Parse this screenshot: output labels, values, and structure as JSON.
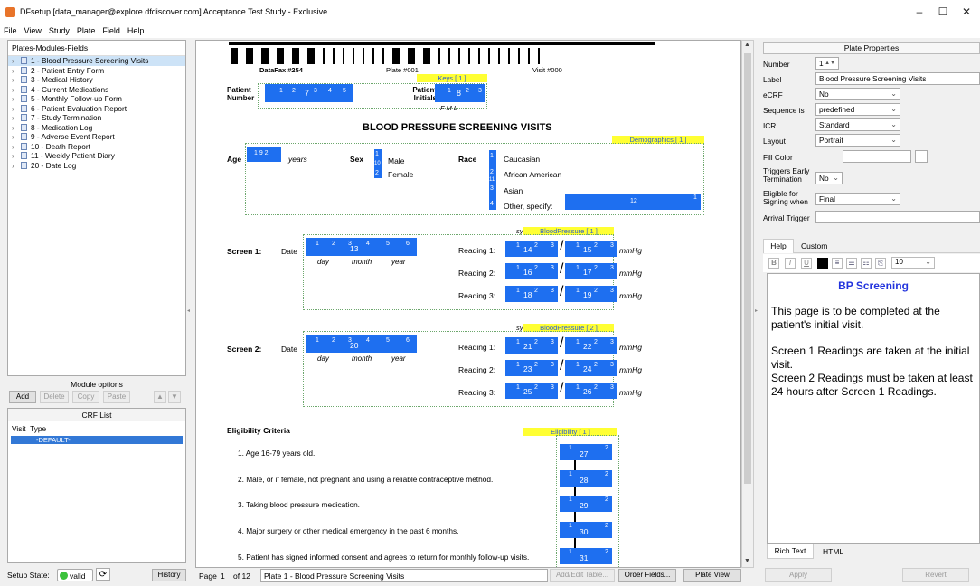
{
  "window": {
    "title": "DFsetup [data_manager@explore.dfdiscover.com] Acceptance Test Study - Exclusive",
    "controls": [
      "–",
      "☐",
      "✕"
    ]
  },
  "menu": [
    "File",
    "View",
    "Study",
    "Plate",
    "Field",
    "Help"
  ],
  "tree": {
    "header": "Plates-Modules-Fields",
    "items": [
      "1 - Blood Pressure Screening Visits",
      "2 - Patient Entry Form",
      "3 - Medical History",
      "4 - Current Medications",
      "5 - Monthly Follow-up Form",
      "6 - Patient Evaluation Report",
      "7 - Study Termination",
      "8 - Medication Log",
      "9 - Adverse Event Report",
      "10 - Death Report",
      "11 - Weekly Patient Diary",
      "20 - Date Log"
    ]
  },
  "module_options": {
    "label": "Module options",
    "buttons": [
      "Add",
      "Delete",
      "Copy",
      "Paste"
    ]
  },
  "crf_list": {
    "title": "CRF List",
    "columns": [
      "Visit",
      "Type"
    ],
    "rows": [
      "-DEFAULT-"
    ]
  },
  "status": {
    "label": "Setup State:",
    "value": "valid",
    "history": "History"
  },
  "form": {
    "header": {
      "datafax": "DataFax #254",
      "plate": "Plate #001",
      "visit": "Visit #000"
    },
    "keys_tag": "Keys [ 1 ]",
    "patient_number_label": "Patient Number",
    "patient_initials_label": "Patient Initials",
    "initials_letters": "F   M   L",
    "title": "BLOOD PRESSURE SCREENING VISITS",
    "demographics_tag": "Demographics [ 1 ]",
    "age_label": "Age",
    "years": "years",
    "sex_label": "Sex",
    "sex_options": [
      "Male",
      "Female"
    ],
    "race_label": "Race",
    "race_options": [
      "Caucasian",
      "African American",
      "Asian",
      "Other, specify:"
    ],
    "bp1_tag": "BloodPressure [ 1 ]",
    "bp2_tag": "BloodPressure [ 2 ]",
    "sys": "sy",
    "screen1": "Screen 1:",
    "screen2": "Screen 2:",
    "date": "Date",
    "day": "day",
    "month": "month",
    "year": "year",
    "readings": [
      "Reading 1:",
      "Reading 2:",
      "Reading 3:"
    ],
    "mmhg": "mmHg",
    "eligibility_title": "Eligibility Criteria",
    "eligibility_tag": "Eligibility [ 1 ]",
    "criteria": [
      "1.  Age 16-79 years old.",
      "2.  Male, or if female, not pregnant and using a reliable contraceptive method.",
      "3.  Taking blood pressure medication.",
      "4.  Major surgery or other medical emergency in the past 6 months.",
      "5.  Patient has signed informed consent and agrees to return for monthly follow-up visits."
    ],
    "field_numbers": {
      "age": "1  9  2",
      "other": "12",
      "s1_date": "13",
      "s1_r": [
        "14",
        "15",
        "16",
        "17",
        "18",
        "19"
      ],
      "s2_date": "20",
      "s2_r": [
        "21",
        "22",
        "23",
        "24",
        "25",
        "26"
      ],
      "elig": [
        "27",
        "28",
        "29",
        "30",
        "31"
      ],
      "pid": "7",
      "init": "8"
    }
  },
  "bottom_bar": {
    "page_label": "Page",
    "page": "1",
    "of": "of 12",
    "plate_name": "Plate 1 - Blood Pressure Screening Visits",
    "buttons": [
      "Add/Edit Table...",
      "Order Fields...",
      "Plate View"
    ]
  },
  "properties": {
    "title": "Plate Properties",
    "number_label": "Number",
    "number": "1",
    "label_label": "Label",
    "label": "Blood Pressure Screening Visits",
    "ecrf_label": "eCRF",
    "ecrf": "No",
    "sequence_label": "Sequence is",
    "sequence": "predefined",
    "icr_label": "ICR",
    "icr": "Standard",
    "layout_label": "Layout",
    "layout": "Portrait",
    "fill_label": "Fill Color",
    "triggers_label": "Triggers Early Termination",
    "triggers": "No",
    "eligible_label": "Eligible for Signing when",
    "eligible": "Final",
    "arrival_label": "Arrival Trigger"
  },
  "help": {
    "tabs": [
      "Help",
      "Custom"
    ],
    "font_size": "10",
    "heading": "BP Screening",
    "paragraphs": [
      "This page is to be completed at the patient's initial visit.",
      "Screen 1 Readings are taken at the initial visit.",
      "Screen 2 Readings must be taken at least 24 hours after Screen 1 Readings."
    ],
    "bottom_tabs": [
      "Rich Text",
      "HTML"
    ],
    "apply": "Apply",
    "revert": "Revert"
  },
  "colors": {
    "field_blue": "#1e6ff0",
    "tag_yellow": "#ffff33",
    "selection": "#cde3f7",
    "valid_green": "#3cc23c"
  }
}
